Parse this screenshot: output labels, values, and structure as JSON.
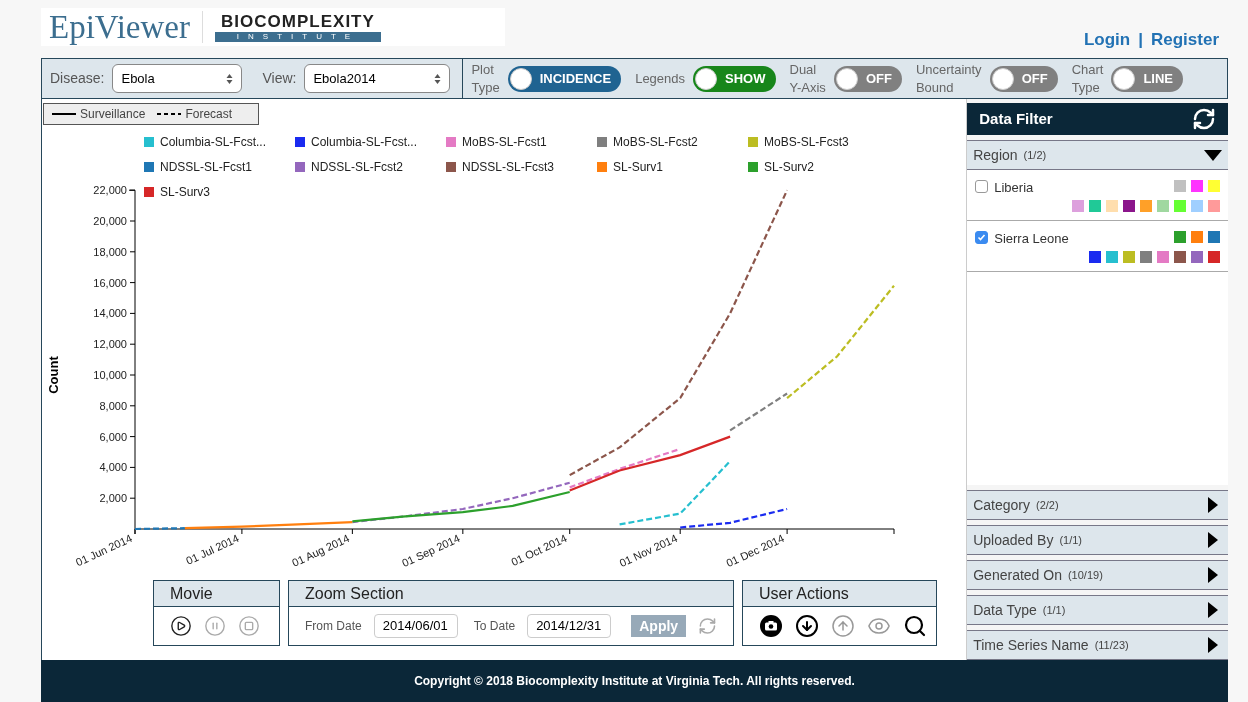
{
  "logo": {
    "title": "EpiViewer",
    "org": "BIOCOMPLEXITY",
    "org_sub": "INSTITUTE"
  },
  "auth_links": [
    "Login",
    "|",
    "Register"
  ],
  "toolbar": {
    "selects": [
      {
        "label": "Disease:",
        "value": "Ebola"
      },
      {
        "label": "View:",
        "value": "Ebola2014"
      }
    ],
    "toggles": [
      {
        "label": "Plot Type",
        "value": "INCIDENCE",
        "on": true,
        "color": "#1f6391"
      },
      {
        "label": "Legends",
        "value": "SHOW",
        "on": true,
        "color": "#17861a"
      },
      {
        "label": "Dual Y-Axis",
        "value": "OFF",
        "on": false
      },
      {
        "label": "Uncertainty Bound",
        "value": "OFF",
        "on": false
      },
      {
        "label": "Chart Type",
        "value": "LINE",
        "on": false
      }
    ]
  },
  "line_style_legend": [
    {
      "label": "Surveillance",
      "kind": "solid"
    },
    {
      "label": "Forecast",
      "kind": "dashed"
    }
  ],
  "chart_data": {
    "type": "line",
    "ylabel": "Count",
    "legend": "top",
    "xlim": [
      "2014-06-01",
      "2014-12-31"
    ],
    "ylim": [
      0,
      22000
    ],
    "yticks": [
      {
        "value": 2000,
        "label": "2,000"
      },
      {
        "value": 4000,
        "label": "4,000"
      },
      {
        "value": 6000,
        "label": "6,000"
      },
      {
        "value": 8000,
        "label": "8,000"
      },
      {
        "value": 10000,
        "label": "10,000"
      },
      {
        "value": 12000,
        "label": "12,000"
      },
      {
        "value": 14000,
        "label": "14,000"
      },
      {
        "value": 16000,
        "label": "16,000"
      },
      {
        "value": 18000,
        "label": "18,000"
      },
      {
        "value": 20000,
        "label": "20,000"
      },
      {
        "value": 22000,
        "label": "22,000"
      }
    ],
    "x": [
      "2014-06-01",
      "2014-06-15",
      "2014-07-01",
      "2014-07-15",
      "2014-08-01",
      "2014-08-15",
      "2014-09-01",
      "2014-09-15",
      "2014-10-01",
      "2014-10-15",
      "2014-11-01",
      "2014-11-15",
      "2014-12-01",
      "2014-12-15",
      "2014-12-31"
    ],
    "xticks": [
      {
        "value": "2014-06-01",
        "label": "01 Jun 2014"
      },
      {
        "value": "2014-07-01",
        "label": "01 Jul 2014"
      },
      {
        "value": "2014-08-01",
        "label": "01 Aug 2014"
      },
      {
        "value": "2014-09-01",
        "label": "01 Sep 2014"
      },
      {
        "value": "2014-10-01",
        "label": "01 Oct 2014"
      },
      {
        "value": "2014-11-01",
        "label": "01 Nov 2014"
      },
      {
        "value": "2014-12-01",
        "label": "01 Dec 2014"
      }
    ],
    "series": [
      {
        "name": "Columbia-SL-Fcst...",
        "color": "#26bfcf",
        "line_style": "dashed",
        "values": [
          null,
          null,
          null,
          null,
          null,
          null,
          null,
          null,
          null,
          300,
          1000,
          4400,
          null,
          null,
          null
        ]
      },
      {
        "name": "Columbia-SL-Fcst...",
        "color": "#1a2bf0",
        "line_style": "dashed",
        "values": [
          null,
          null,
          null,
          null,
          null,
          null,
          null,
          null,
          null,
          null,
          100,
          400,
          1300,
          null,
          null
        ]
      },
      {
        "name": "MoBS-SL-Fcst1",
        "color": "#e47ac4",
        "line_style": "dashed",
        "values": [
          null,
          null,
          null,
          null,
          null,
          null,
          null,
          null,
          2700,
          3900,
          5200,
          null,
          null,
          null,
          null
        ]
      },
      {
        "name": "MoBS-SL-Fcst2",
        "color": "#7f7f7f",
        "line_style": "dashed",
        "values": [
          null,
          null,
          null,
          null,
          null,
          null,
          null,
          null,
          null,
          null,
          null,
          6400,
          8800,
          null,
          null
        ]
      },
      {
        "name": "MoBS-SL-Fcst3",
        "color": "#bcbd22",
        "line_style": "dashed",
        "values": [
          null,
          null,
          null,
          null,
          null,
          null,
          null,
          null,
          null,
          null,
          null,
          null,
          8500,
          11200,
          15800
        ]
      },
      {
        "name": "NDSSL-SL-Fcst1",
        "color": "#1f77b4",
        "line_style": "dashed",
        "values": [
          0,
          50,
          null,
          null,
          null,
          null,
          null,
          null,
          null,
          null,
          null,
          null,
          null,
          null,
          null
        ]
      },
      {
        "name": "NDSSL-SL-Fcst2",
        "color": "#9467bd",
        "line_style": "dashed",
        "values": [
          null,
          null,
          null,
          null,
          450,
          800,
          1300,
          2000,
          3000,
          null,
          null,
          null,
          null,
          null,
          null
        ]
      },
      {
        "name": "NDSSL-SL-Fcst3",
        "color": "#8c564b",
        "line_style": "dashed",
        "values": [
          null,
          null,
          null,
          null,
          null,
          null,
          null,
          null,
          3500,
          5300,
          8500,
          14000,
          22000,
          null,
          null
        ]
      },
      {
        "name": "SL-Surv1",
        "color": "#ff7f0e",
        "line_style": "solid",
        "values": [
          null,
          60,
          150,
          280,
          450,
          null,
          null,
          null,
          null,
          null,
          null,
          null,
          null,
          null,
          null
        ]
      },
      {
        "name": "SL-Surv2",
        "color": "#2ca02c",
        "line_style": "solid",
        "values": [
          null,
          null,
          null,
          null,
          500,
          800,
          1100,
          1500,
          2400,
          null,
          null,
          null,
          null,
          null,
          null
        ]
      },
      {
        "name": "SL-Surv3",
        "color": "#d62728",
        "line_style": "solid",
        "values": [
          null,
          null,
          null,
          null,
          null,
          null,
          null,
          null,
          2500,
          3800,
          4800,
          6000,
          null,
          null,
          null
        ]
      }
    ]
  },
  "movie": {
    "title": "Movie",
    "controls": [
      {
        "kind": "play",
        "disabled": false
      },
      {
        "kind": "pause",
        "disabled": true
      },
      {
        "kind": "stop",
        "disabled": true
      }
    ]
  },
  "zoom_section": {
    "title": "Zoom Section",
    "from_label": "From Date",
    "from_value": "2014/06/01",
    "to_label": "To Date",
    "to_value": "2014/12/31",
    "apply": "Apply"
  },
  "user_actions": {
    "title": "User Actions",
    "actions": [
      {
        "kind": "camera",
        "disabled": false
      },
      {
        "kind": "download",
        "disabled": false
      },
      {
        "kind": "upload",
        "disabled": true
      },
      {
        "kind": "view",
        "disabled": true
      },
      {
        "kind": "analyze",
        "disabled": false
      }
    ]
  },
  "data_filter": {
    "title": "Data Filter",
    "sections": [
      {
        "title": "Region",
        "count": "(1/2)",
        "expanded": true,
        "items": [
          {
            "label": "Liberia",
            "checked": false,
            "colors": [
              {
                "color": "#c0c0c0"
              },
              {
                "color": "#ff33ff"
              },
              {
                "color": "#ffff33"
              },
              {
                "color": "#dda0dd"
              },
              {
                "color": "#20c997"
              },
              {
                "color": "#ffdead"
              },
              {
                "color": "#8b158b"
              },
              {
                "color": "#ffa028"
              },
              {
                "color": "#a0d8a0"
              },
              {
                "color": "#66ff33"
              },
              {
                "color": "#a0cfff"
              },
              {
                "color": "#ff9a9a"
              }
            ]
          },
          {
            "label": "Sierra Leone",
            "checked": true,
            "colors": [
              {
                "color": "#2ca02c"
              },
              {
                "color": "#ff7f0e"
              },
              {
                "color": "#1f77b4"
              },
              {
                "color": "#1a2bf0"
              },
              {
                "color": "#26bfcf"
              },
              {
                "color": "#bcbd22"
              },
              {
                "color": "#7f7f7f"
              },
              {
                "color": "#e47ac4"
              },
              {
                "color": "#8c564b"
              },
              {
                "color": "#9467bd"
              },
              {
                "color": "#d62728"
              }
            ]
          }
        ]
      },
      {
        "title": "Category",
        "count": "(2/2)",
        "expanded": false
      },
      {
        "title": "Uploaded By",
        "count": "(1/1)",
        "expanded": false
      },
      {
        "title": "Generated On",
        "count": "(10/19)",
        "expanded": false
      },
      {
        "title": "Data Type",
        "count": "(1/1)",
        "expanded": false
      },
      {
        "title": "Time Series Name",
        "count": "(11/23)",
        "expanded": false
      }
    ]
  },
  "footer": "Copyright © 2018 Biocomplexity Institute at Virginia Tech. All rights reserved."
}
